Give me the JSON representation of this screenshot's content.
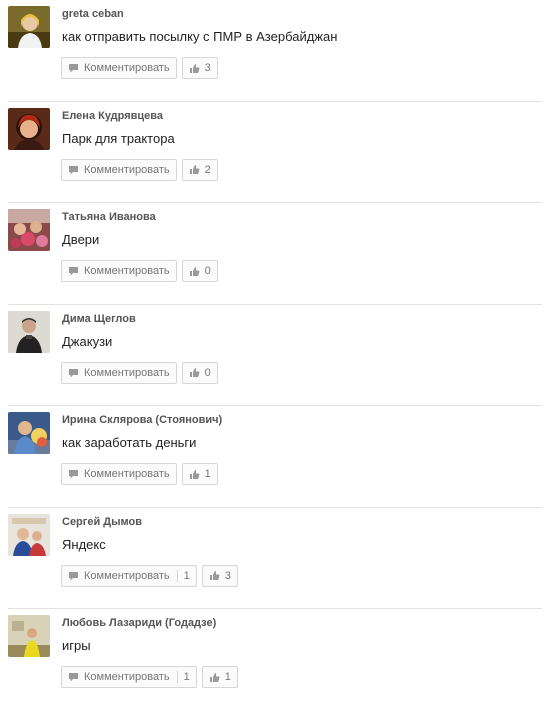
{
  "comment_label": "Комментировать",
  "icons": {
    "comment": "speech-bubble-icon",
    "like": "thumbs-up-icon"
  },
  "posts": [
    {
      "author": "greta ceban",
      "text": "как отправить посылку с ПМР в Азербайджан",
      "comments": "",
      "likes": "3"
    },
    {
      "author": "Елена Кудрявцева",
      "text": "Парк для трактора",
      "comments": "",
      "likes": "2"
    },
    {
      "author": "Татьяна Иванова",
      "text": "Двери",
      "comments": "",
      "likes": "0"
    },
    {
      "author": "Дима Щеглов",
      "text": "Джакузи",
      "comments": "",
      "likes": "0"
    },
    {
      "author": "Ирина Склярова (Стоянович)",
      "text": "как заработать деньги",
      "comments": "",
      "likes": "1"
    },
    {
      "author": "Сергей Дымов",
      "text": "Яндекс",
      "comments": "1",
      "likes": "3"
    },
    {
      "author": "Любовь Лазариди (Годадзе)",
      "text": "игры",
      "comments": "1",
      "likes": "1"
    }
  ]
}
